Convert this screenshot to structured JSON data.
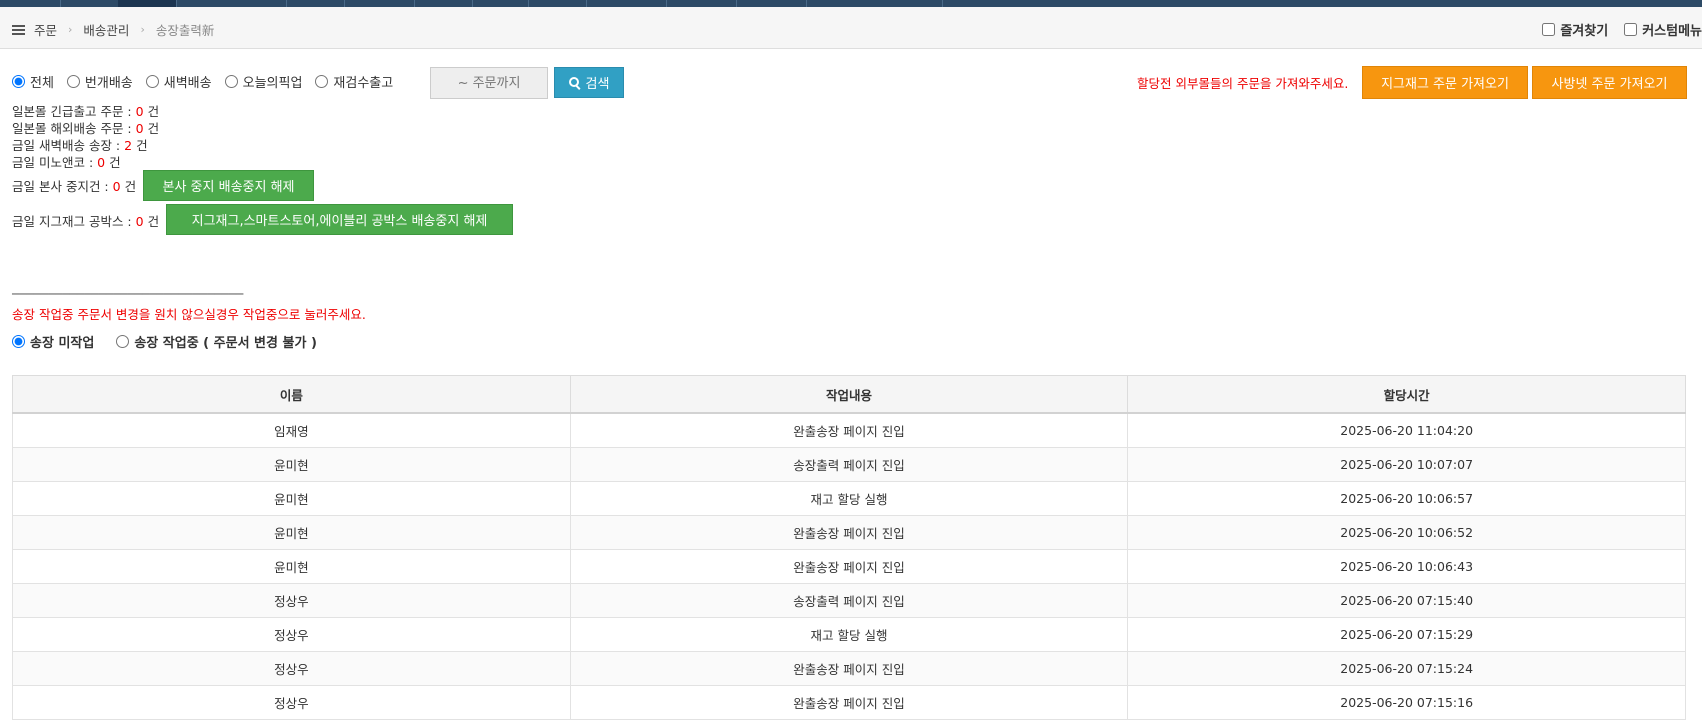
{
  "breadcrumb": {
    "items": [
      "주문",
      "배송관리",
      "송장출력新"
    ]
  },
  "top_right": {
    "favorites_label": "즐겨찾기",
    "custom_menu_label": "커스텀메뉴"
  },
  "filters": {
    "options": [
      "전체",
      "번개배송",
      "새벽배송",
      "오늘의픽업",
      "재검수출고"
    ],
    "selected": "전체",
    "date_placeholder": "~ 주문까지",
    "search_label": "검색"
  },
  "import": {
    "note": "할당전 외부몰들의 주문을 가져와주세요.",
    "zigzag_label": "지그재그 주문 가져오기",
    "sabang_label": "사방넷 주문 가져오기"
  },
  "stats": {
    "jp_urgent": {
      "label": "일본몰 긴급출고 주문 :",
      "count": "0",
      "unit": "건"
    },
    "jp_overseas": {
      "label": "일본몰 해외배송 주문 :",
      "count": "0",
      "unit": "건"
    },
    "dawn_invoice": {
      "label": "금일 새벽배송 송장 :",
      "count": "2",
      "unit": "건"
    },
    "minoanko": {
      "label": "금일 미노앤코 :",
      "count": "0",
      "unit": "건"
    },
    "hq_stop": {
      "label": "금일 본사 중지건 :",
      "count": "0",
      "unit": "건",
      "button": "본사 중지 배송중지 해제"
    },
    "zigzag_box": {
      "label": "금일 지그재그 공박스 :",
      "count": "0",
      "unit": "건",
      "button": "지그재그,스마트스토어,에이블리 공박스 배송중지 해제"
    }
  },
  "divider": "────────────────────────────────",
  "warning": "송장 작업중 주문서 변경을 원치 않으실경우 작업중으로 눌러주세요.",
  "work_status": {
    "not_working": "송장 미작업",
    "working": "송장 작업중 ( 주문서 변경 불가 )",
    "selected": "송장 미작업"
  },
  "table": {
    "headers": [
      "이름",
      "작업내용",
      "할당시간"
    ],
    "rows": [
      [
        "임재영",
        "완출송장 페이지 진입",
        "2025-06-20 11:04:20"
      ],
      [
        "윤미현",
        "송장출력 페이지 진입",
        "2025-06-20 10:07:07"
      ],
      [
        "윤미현",
        "재고 할당 실행",
        "2025-06-20 10:06:57"
      ],
      [
        "윤미현",
        "완출송장 페이지 진입",
        "2025-06-20 10:06:52"
      ],
      [
        "윤미현",
        "완출송장 페이지 진입",
        "2025-06-20 10:06:43"
      ],
      [
        "정상우",
        "송장출력 페이지 진입",
        "2025-06-20 07:15:40"
      ],
      [
        "정상우",
        "재고 할당 실행",
        "2025-06-20 07:15:29"
      ],
      [
        "정상우",
        "완출송장 페이지 진입",
        "2025-06-20 07:15:24"
      ],
      [
        "정상우",
        "완출송장 페이지 진입",
        "2025-06-20 07:15:16"
      ]
    ]
  }
}
